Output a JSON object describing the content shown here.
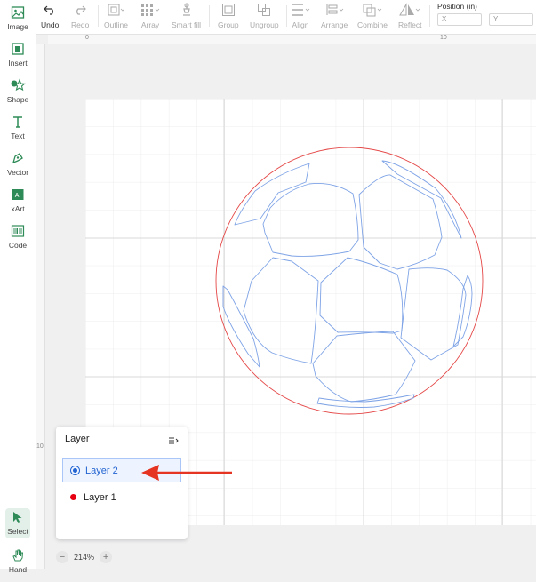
{
  "sidebar": {
    "items": [
      {
        "label": "Image",
        "icon": "image-icon"
      },
      {
        "label": "Insert",
        "icon": "insert-icon"
      },
      {
        "label": "Shape",
        "icon": "shape-icon"
      },
      {
        "label": "Text",
        "icon": "text-icon"
      },
      {
        "label": "Vector",
        "icon": "vector-pen-icon"
      },
      {
        "label": "xArt",
        "icon": "ai-art-icon"
      },
      {
        "label": "Code",
        "icon": "barcode-icon"
      },
      {
        "label": "Select",
        "icon": "select-cursor-icon"
      },
      {
        "label": "Hand",
        "icon": "hand-icon"
      }
    ],
    "active_color": "#2e8b57"
  },
  "toolbar": {
    "undo": "Undo",
    "redo": "Redo",
    "outline": "Outline",
    "array": "Array",
    "smart_fill": "Smart fill",
    "group": "Group",
    "ungroup": "Ungroup",
    "align": "Align",
    "arrange": "Arrange",
    "combine": "Combine",
    "reflect": "Reflect",
    "position_label": "Position (in)",
    "x_placeholder": "X",
    "y_placeholder": "Y"
  },
  "rulers": {
    "top": [
      "0",
      "10"
    ],
    "left": [
      "10"
    ]
  },
  "layers": {
    "title": "Layer",
    "items": [
      {
        "name": "Layer 2",
        "color": "#2264d1",
        "selected": true
      },
      {
        "name": "Layer 1",
        "color": "#e60012",
        "selected": false
      }
    ]
  },
  "zoom": {
    "minus": "−",
    "value": "214%",
    "plus": "+"
  },
  "colors": {
    "accent": "#2264d1",
    "cut_red": "#e54848",
    "ball_blue": "#7ea3e6",
    "annotation_arrow": "#e53422"
  }
}
